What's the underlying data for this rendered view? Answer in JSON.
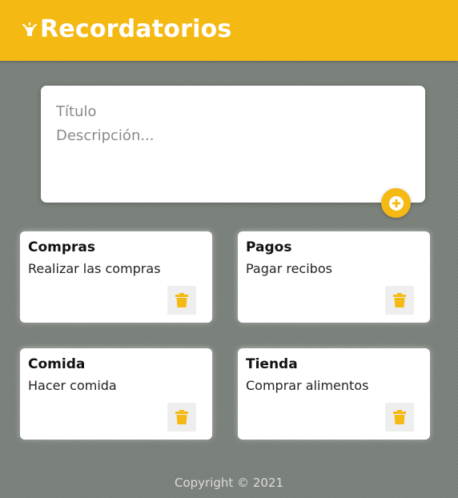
{
  "header": {
    "title": "Recordatorios",
    "icon": "lightbulb-icon",
    "background_color": "#f5b914"
  },
  "form": {
    "title_placeholder": "Título",
    "title_value": "",
    "description_placeholder": "Descripción...",
    "description_value": "",
    "add_icon": "plus-circle-icon"
  },
  "notes": [
    {
      "title": "Compras",
      "description": "Realizar las compras",
      "delete_icon": "trash-icon"
    },
    {
      "title": "Pagos",
      "description": "Pagar recibos",
      "delete_icon": "trash-icon"
    },
    {
      "title": "Comida",
      "description": "Hacer comida",
      "delete_icon": "trash-icon"
    },
    {
      "title": "Tienda",
      "description": "Comprar alimentos",
      "delete_icon": "trash-icon"
    }
  ],
  "footer": {
    "text": "Copyright © 2021"
  },
  "colors": {
    "accent": "#f5b914",
    "background": "#7b817b",
    "card": "#ffffff",
    "delete_button_bg": "#eeeeee"
  }
}
